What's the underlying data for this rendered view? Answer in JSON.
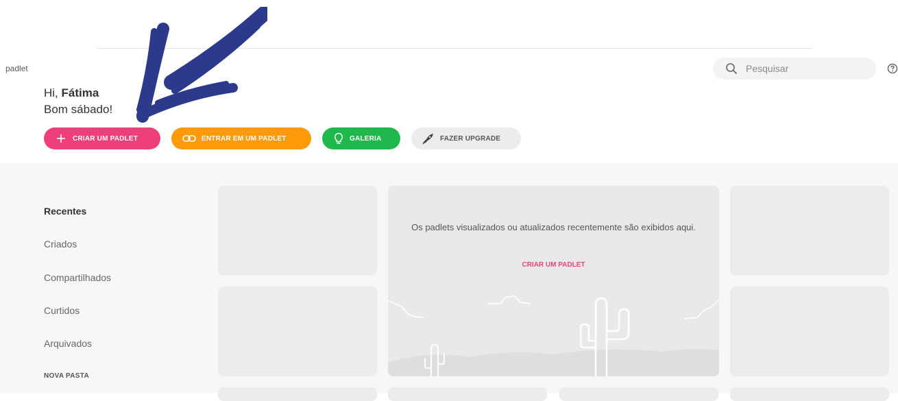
{
  "app": {
    "logo_text": "padlet"
  },
  "search": {
    "placeholder": "Pesquisar"
  },
  "greeting": {
    "hi": "Hi,",
    "name": "Fátima",
    "line2": "Bom sábado!"
  },
  "actions": {
    "create": "CRIAR UM PADLET",
    "join": "ENTRAR EM UM PADLET",
    "gallery": "GALERIA",
    "upgrade": "FAZER UPGRADE"
  },
  "sidebar": {
    "items": [
      {
        "label": "Recentes",
        "active": true
      },
      {
        "label": "Criados"
      },
      {
        "label": "Compartilhados"
      },
      {
        "label": "Curtidos"
      },
      {
        "label": "Arquivados"
      }
    ],
    "new_folder": "NOVA PASTA"
  },
  "empty_state": {
    "message": "Os padlets visualizados ou atualizados recentemente são exibidos aqui.",
    "link": "CRIAR UM PADLET"
  },
  "colors": {
    "create": "#ee3f78",
    "join": "#ff9a0b",
    "gallery": "#1fb84d",
    "upgrade": "#ececec",
    "annotation_arrow": "#2b3a8a"
  },
  "icons": [
    "search-icon",
    "help-icon",
    "plus-icon",
    "link-icon",
    "lightbulb-icon",
    "rocket-icon",
    "cactus-icon"
  ]
}
